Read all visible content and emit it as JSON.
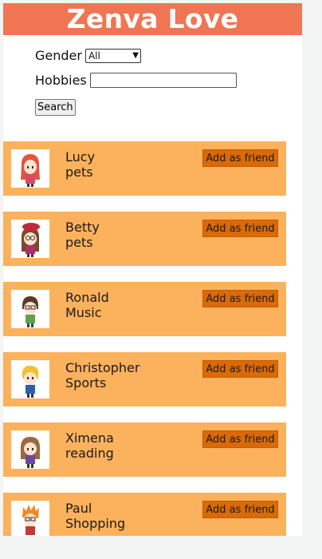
{
  "header": {
    "title": "Zenva Love",
    "bg_color": "#f07552"
  },
  "search": {
    "gender_label": "Gender",
    "gender_value": "All",
    "hobbies_label": "Hobbies",
    "hobbies_value": "",
    "button_label": "Search"
  },
  "profiles": [
    {
      "name": "Lucy",
      "hobby": "pets",
      "button": "Add as friend",
      "avatar": "girl-red-hair-avatar-icon"
    },
    {
      "name": "Betty",
      "hobby": "pets",
      "button": "Add as friend",
      "avatar": "girl-beret-glasses-avatar-icon"
    },
    {
      "name": "Ronald",
      "hobby": "Music",
      "button": "Add as friend",
      "avatar": "boy-glasses-avatar-icon"
    },
    {
      "name": "Christopher",
      "hobby": "Sports",
      "button": "Add as friend",
      "avatar": "boy-blonde-avatar-icon"
    },
    {
      "name": "Ximena",
      "hobby": "reading",
      "button": "Add as friend",
      "avatar": "girl-brown-hair-avatar-icon"
    },
    {
      "name": "Paul",
      "hobby": "Shopping",
      "button": "Add as friend",
      "avatar": "boy-orange-hair-avatar-icon"
    }
  ],
  "colors": {
    "card_bg": "#fcb15c",
    "button_bg": "#d96a07"
  }
}
